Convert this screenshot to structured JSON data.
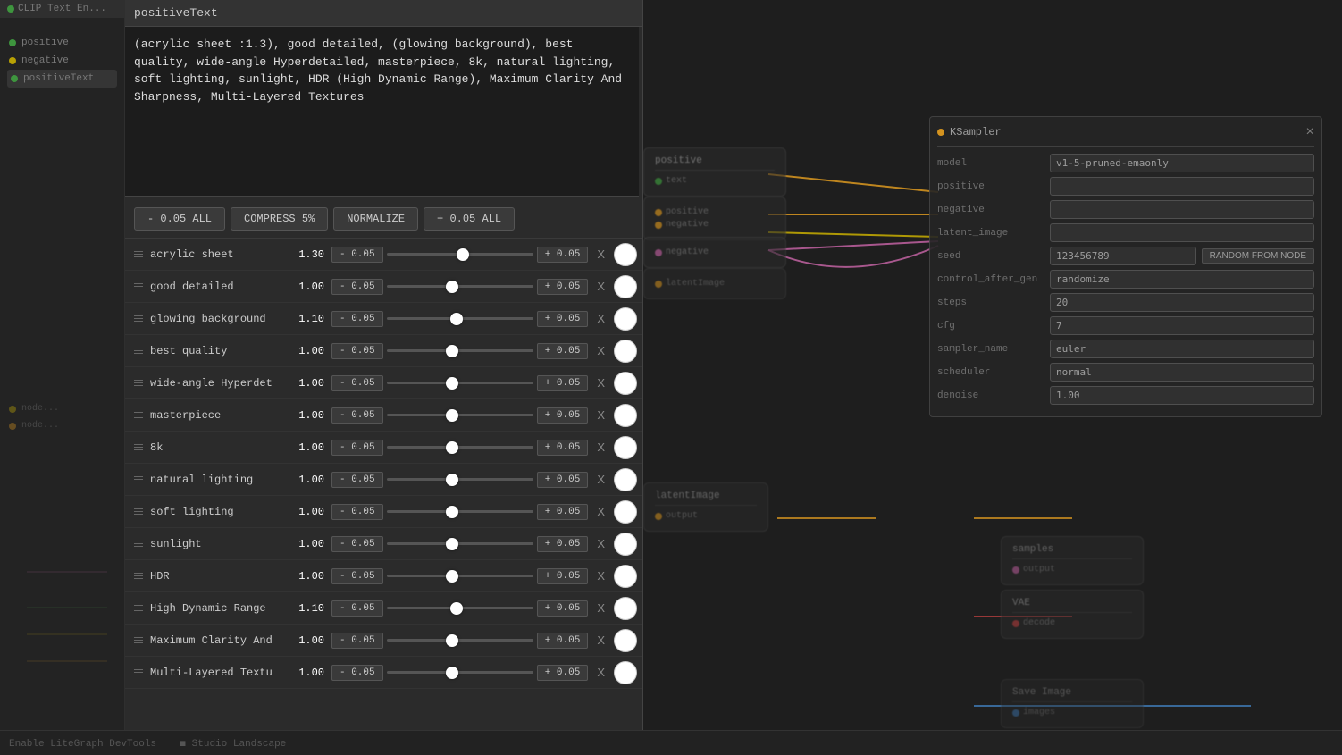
{
  "window": {
    "title": "positiveText"
  },
  "prompt": {
    "text": "(acrylic sheet :1.3), good detailed, (glowing background), best quality, wide-angle Hyperdetailed, masterpiece, 8k, natural lighting, soft lighting, sunlight, HDR (High Dynamic Range), Maximum Clarity And Sharpness, Multi-Layered Textures"
  },
  "toolbar": {
    "minus_all": "- 0.05 ALL",
    "compress": "COMPRESS 5%",
    "normalize": "NORMALIZE",
    "plus_all": "+ 0.05 ALL"
  },
  "tokens": [
    {
      "name": "acrylic sheet",
      "value": "1.30",
      "slider_pct": 0.52
    },
    {
      "name": "good detailed",
      "value": "1.00",
      "slider_pct": 0.45
    },
    {
      "name": "glowing background",
      "value": "1.10",
      "slider_pct": 0.48
    },
    {
      "name": "best quality",
      "value": "1.00",
      "slider_pct": 0.45
    },
    {
      "name": "wide-angle Hyperdet",
      "value": "1.00",
      "slider_pct": 0.45
    },
    {
      "name": "masterpiece",
      "value": "1.00",
      "slider_pct": 0.45
    },
    {
      "name": "8k",
      "value": "1.00",
      "slider_pct": 0.45
    },
    {
      "name": "natural lighting",
      "value": "1.00",
      "slider_pct": 0.45
    },
    {
      "name": "soft lighting",
      "value": "1.00",
      "slider_pct": 0.45
    },
    {
      "name": "sunlight",
      "value": "1.00",
      "slider_pct": 0.45
    },
    {
      "name": "HDR",
      "value": "1.00",
      "slider_pct": 0.45
    },
    {
      "name": "High Dynamic Range",
      "value": "1.10",
      "slider_pct": 0.48
    },
    {
      "name": "Maximum Clarity And",
      "value": "1.00",
      "slider_pct": 0.45
    },
    {
      "name": "Multi-Layered Textu",
      "value": "1.00",
      "slider_pct": 0.45
    }
  ],
  "minus_label": "- 0.05",
  "plus_label": "+ 0.05",
  "x_label": "X",
  "sidebar": {
    "tab_label": "CLIP Text En...",
    "items": [
      {
        "label": "positive",
        "dot": "green"
      },
      {
        "label": "negative",
        "dot": "yellow"
      },
      {
        "label": "positiveText",
        "dot": "green"
      }
    ]
  },
  "right_panel": {
    "title": "KSampler",
    "fields": [
      {
        "label": "model",
        "value": "v1-5-pruned-emaonly"
      },
      {
        "label": "positive",
        "value": ""
      },
      {
        "label": "negative",
        "value": ""
      },
      {
        "label": "latent_image",
        "value": ""
      },
      {
        "label": "seed",
        "value": "123456789",
        "extra": "RANDOM FROM NODE"
      },
      {
        "label": "control_after_gen",
        "value": "randomize"
      },
      {
        "label": "steps",
        "value": "20"
      },
      {
        "label": "cfg",
        "value": "7"
      },
      {
        "label": "sampler_name",
        "value": "euler"
      },
      {
        "label": "scheduler",
        "value": "normal"
      },
      {
        "label": "denoise",
        "value": "1.00"
      }
    ]
  }
}
